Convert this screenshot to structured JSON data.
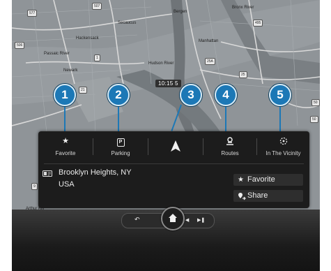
{
  "map": {
    "labels": [
      "Bergen",
      "Secaucus",
      "Passaic River",
      "Newark",
      "Hudson River",
      "Manhattan",
      "Hackensack",
      "Bronx River",
      "Arthur Kill"
    ],
    "shields": [
      "577",
      "507",
      "506",
      "1",
      "21",
      "25A",
      "25",
      "50",
      "9",
      "50",
      "495"
    ],
    "time_badge": "10:15 5"
  },
  "callouts": [
    "1",
    "2",
    "3",
    "4",
    "5"
  ],
  "menu": {
    "favorite": {
      "icon": "star-icon",
      "label": "Favorite"
    },
    "parking": {
      "icon": "parking-icon",
      "label": "Parking"
    },
    "navigate": {
      "icon": "navigation-arrow-icon"
    },
    "routes": {
      "icon": "routes-icon",
      "label": "Routes"
    },
    "vicinity": {
      "icon": "vicinity-icon",
      "label": "In The Vicinity"
    }
  },
  "address": {
    "line1": "Brooklyn Heights, NY",
    "line2": "USA"
  },
  "actions": {
    "favorite": {
      "icon": "star-icon",
      "label": "Favorite"
    },
    "share": {
      "icon": "share-location-icon",
      "label": "Share"
    }
  },
  "controls": {
    "back": "back-icon",
    "home": "home-icon",
    "prev": "previous-track-icon",
    "next": "next-track-icon"
  },
  "colors": {
    "callout": "#1c78b6",
    "panel": "#1c1c1c",
    "map": "#8d9296"
  }
}
